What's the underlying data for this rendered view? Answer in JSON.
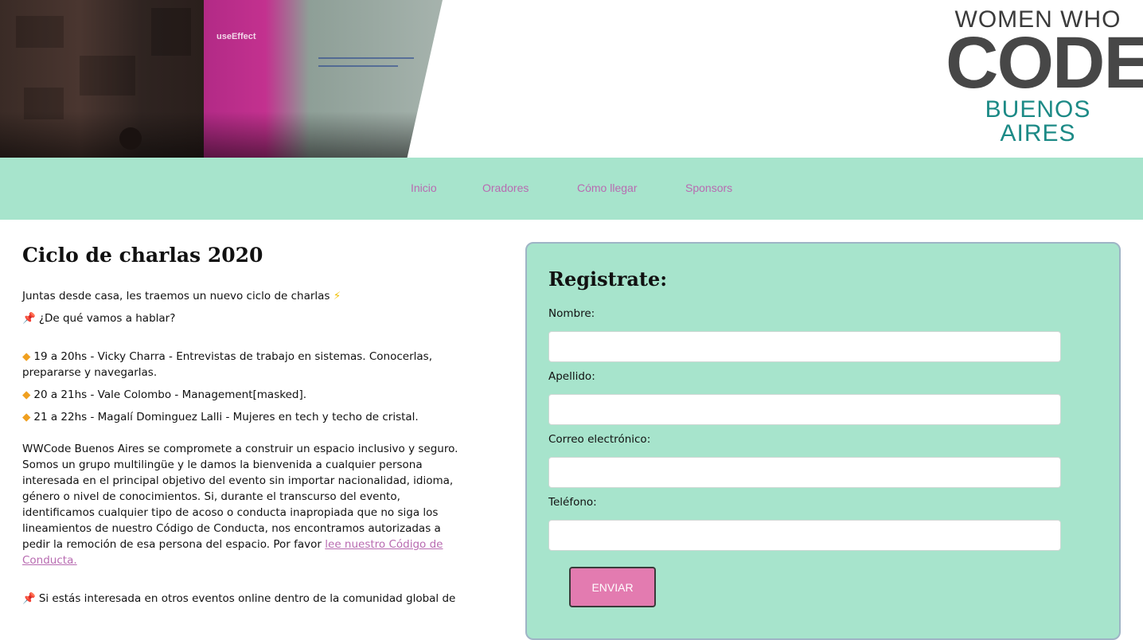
{
  "header": {
    "logo": {
      "line1": "WOMEN WHO",
      "line2": "CODE",
      "line3": "BUENOS AIRES"
    },
    "hero_screen_title": "useEffect"
  },
  "nav": {
    "items": [
      {
        "label": "Inicio"
      },
      {
        "label": "Oradores"
      },
      {
        "label": "Cómo llegar"
      },
      {
        "label": "Sponsors"
      }
    ]
  },
  "main": {
    "title": "Ciclo de charlas 2020",
    "intro": "Juntas desde casa, les traemos un nuevo ciclo de charlas",
    "question": "¿De qué vamos a hablar?",
    "talks": [
      "19 a 20hs - Vicky Charra - Entrevistas de trabajo en sistemas. Conocerlas, prepararse y navegarlas.",
      "20 a 21hs - Vale Colombo - Management[masked].",
      "21 a 22hs - Magalí Dominguez Lalli - Mujeres en tech y techo de cristal."
    ],
    "conduct_text": "WWCode Buenos Aires se compromete a construir un espacio inclusivo y seguro. Somos un grupo multilingüe y le damos la bienvenida a cualquier persona interesada en el principal objetivo del evento sin importar nacionalidad, idioma, género o nivel de conocimientos. Si, durante el transcurso del evento, identificamos cualquier tipo de acoso o conducta inapropiada que no siga los lineamientos de nuestro Código de Conducta, nos encontramos autorizadas a pedir la remoción de esa persona del espacio. Por favor ",
    "conduct_link": "lee nuestro Código de Conducta.",
    "more_text": "Si estás interesada en otros eventos online dentro de la comunidad global de"
  },
  "form": {
    "title": "Registrate:",
    "fields": [
      {
        "label": "Nombre:",
        "value": ""
      },
      {
        "label": "Apellido:",
        "value": ""
      },
      {
        "label": "Correo electrónico:",
        "value": ""
      },
      {
        "label": "Teléfono:",
        "value": ""
      }
    ],
    "submit_label": "ENVIAR"
  },
  "colors": {
    "nav_bg": "#a7e4cc",
    "link": "#b86bb1",
    "button": "#e37bb0",
    "logo_teal": "#1c8a86"
  }
}
